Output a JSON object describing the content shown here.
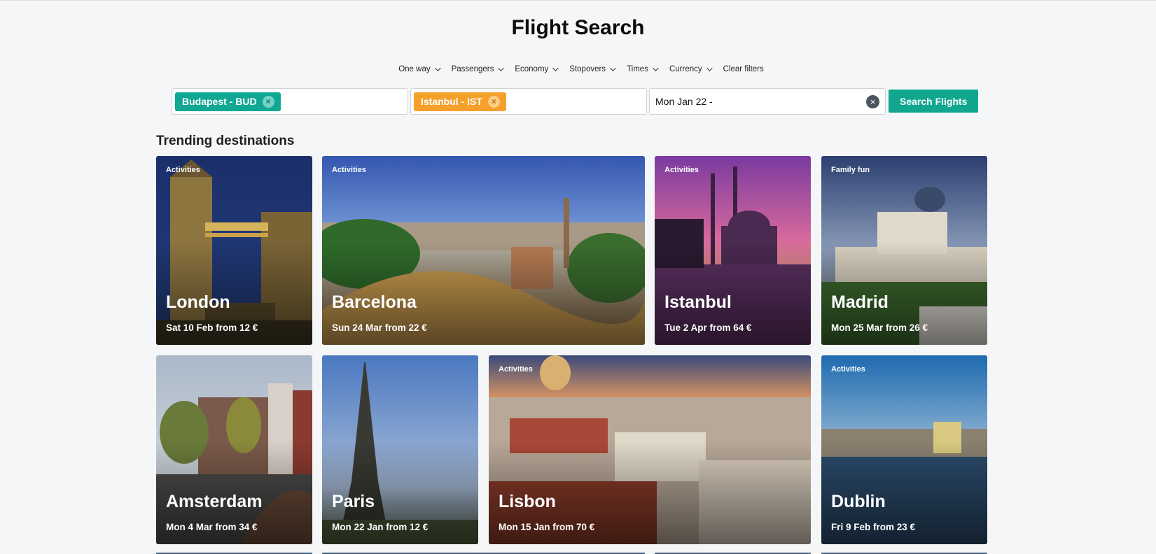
{
  "page": {
    "title": "Flight Search"
  },
  "filters": [
    {
      "label": "One way"
    },
    {
      "label": "Passengers"
    },
    {
      "label": "Economy"
    },
    {
      "label": "Stopovers"
    },
    {
      "label": "Times"
    },
    {
      "label": "Currency"
    }
  ],
  "clear_filters_label": "Clear filters",
  "search": {
    "origin": "Budapest - BUD",
    "destination": "Istanbul - IST",
    "date": "Mon Jan 22 -",
    "remove_glyph": "×",
    "button_label": "Search Flights"
  },
  "section": {
    "title": "Trending destinations"
  },
  "destinations": [
    {
      "tag": "Activities",
      "city": "London",
      "price": "Sat 10 Feb from 12 €"
    },
    {
      "tag": "Activities",
      "city": "Barcelona",
      "price": "Sun 24 Mar from 22 €"
    },
    {
      "tag": "Activities",
      "city": "Istanbul",
      "price": "Tue 2 Apr from 64 €"
    },
    {
      "tag": "Family fun",
      "city": "Madrid",
      "price": "Mon 25 Mar from 26 €"
    },
    {
      "tag": "",
      "city": "Amsterdam",
      "price": "Mon 4 Mar from 34 €"
    },
    {
      "tag": "",
      "city": "Paris",
      "price": "Mon 22 Jan from 12 €"
    },
    {
      "tag": "Activities",
      "city": "Lisbon",
      "price": "Mon 15 Jan from 70 €"
    },
    {
      "tag": "Activities",
      "city": "Dublin",
      "price": "Fri 9 Feb from 23 €"
    }
  ],
  "colors": {
    "accent_green": "#10a893",
    "accent_orange": "#f5a02b",
    "search_button": "#11a78f",
    "background": "#f5f6f7"
  },
  "icons": [
    "chevron-down-icon",
    "remove-chip-icon",
    "clear-date-icon"
  ]
}
